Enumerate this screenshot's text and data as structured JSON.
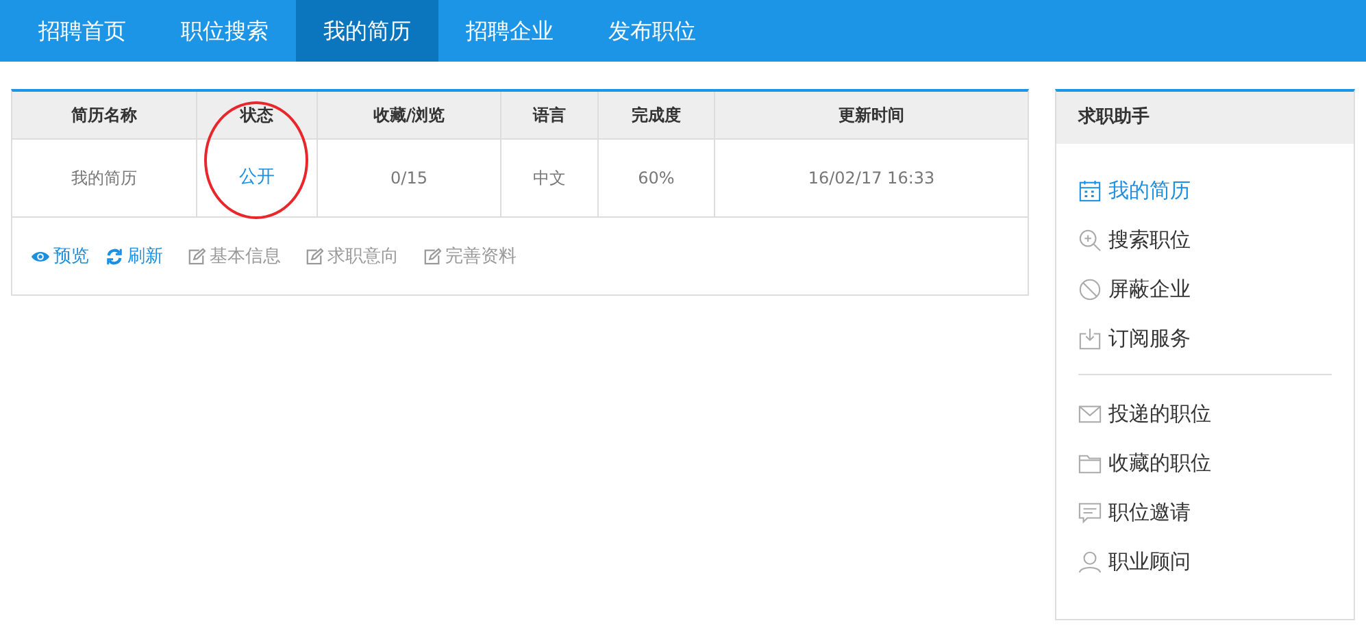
{
  "nav": [
    {
      "label": "招聘首页",
      "selected": false
    },
    {
      "label": "职位搜索",
      "selected": false
    },
    {
      "label": "我的简历",
      "selected": true
    },
    {
      "label": "招聘企业",
      "selected": false
    },
    {
      "label": "发布职位",
      "selected": false
    }
  ],
  "resume_table": {
    "columns": [
      {
        "label": "简历名称",
        "highlighted": false
      },
      {
        "label": "状态",
        "highlighted": true
      },
      {
        "label": "收藏/浏览",
        "highlighted": false
      },
      {
        "label": "语言",
        "highlighted": false
      },
      {
        "label": "完成度",
        "highlighted": false
      },
      {
        "label": "更新时间",
        "highlighted": false
      }
    ],
    "rows": [
      [
        {
          "text": "我的简历",
          "link": false
        },
        {
          "text": "公开",
          "link": true
        },
        {
          "text": "0/15",
          "link": false
        },
        {
          "text": "中文",
          "link": false
        },
        {
          "text": "60%",
          "link": false
        },
        {
          "text": "16/02/17 16:33",
          "link": false
        }
      ]
    ],
    "actions": [
      {
        "label": "预览",
        "kind": "view"
      },
      {
        "label": "刷新",
        "kind": "refresh"
      },
      {
        "label": "基本信息",
        "kind": "edit"
      },
      {
        "label": "求职意向",
        "kind": "edit"
      },
      {
        "label": "完善资料",
        "kind": "edit"
      }
    ]
  },
  "sidebar": {
    "title": "求职助手",
    "groups": [
      [
        {
          "label": "我的简历",
          "kind": "calendar",
          "selected": true
        },
        {
          "label": "搜索职位",
          "kind": "search",
          "selected": false
        },
        {
          "label": "屏蔽企业",
          "kind": "block",
          "selected": false
        },
        {
          "label": "订阅服务",
          "kind": "download",
          "selected": false
        }
      ],
      [
        {
          "label": "投递的职位",
          "kind": "mail",
          "selected": false
        },
        {
          "label": "收藏的职位",
          "kind": "folder",
          "selected": false
        },
        {
          "label": "职位邀请",
          "kind": "chat",
          "selected": false
        },
        {
          "label": "职业顾问",
          "kind": "user",
          "selected": false
        }
      ]
    ]
  }
}
